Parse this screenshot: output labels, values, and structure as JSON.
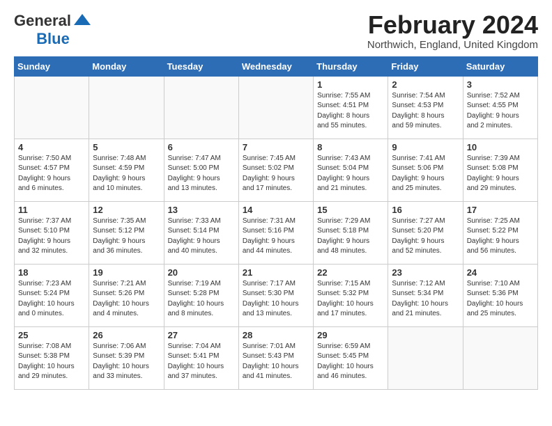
{
  "header": {
    "logo_general": "General",
    "logo_blue": "Blue",
    "month_title": "February 2024",
    "location": "Northwich, England, United Kingdom"
  },
  "days_of_week": [
    "Sunday",
    "Monday",
    "Tuesday",
    "Wednesday",
    "Thursday",
    "Friday",
    "Saturday"
  ],
  "weeks": [
    [
      {
        "num": "",
        "detail": ""
      },
      {
        "num": "",
        "detail": ""
      },
      {
        "num": "",
        "detail": ""
      },
      {
        "num": "",
        "detail": ""
      },
      {
        "num": "1",
        "detail": "Sunrise: 7:55 AM\nSunset: 4:51 PM\nDaylight: 8 hours\nand 55 minutes."
      },
      {
        "num": "2",
        "detail": "Sunrise: 7:54 AM\nSunset: 4:53 PM\nDaylight: 8 hours\nand 59 minutes."
      },
      {
        "num": "3",
        "detail": "Sunrise: 7:52 AM\nSunset: 4:55 PM\nDaylight: 9 hours\nand 2 minutes."
      }
    ],
    [
      {
        "num": "4",
        "detail": "Sunrise: 7:50 AM\nSunset: 4:57 PM\nDaylight: 9 hours\nand 6 minutes."
      },
      {
        "num": "5",
        "detail": "Sunrise: 7:48 AM\nSunset: 4:59 PM\nDaylight: 9 hours\nand 10 minutes."
      },
      {
        "num": "6",
        "detail": "Sunrise: 7:47 AM\nSunset: 5:00 PM\nDaylight: 9 hours\nand 13 minutes."
      },
      {
        "num": "7",
        "detail": "Sunrise: 7:45 AM\nSunset: 5:02 PM\nDaylight: 9 hours\nand 17 minutes."
      },
      {
        "num": "8",
        "detail": "Sunrise: 7:43 AM\nSunset: 5:04 PM\nDaylight: 9 hours\nand 21 minutes."
      },
      {
        "num": "9",
        "detail": "Sunrise: 7:41 AM\nSunset: 5:06 PM\nDaylight: 9 hours\nand 25 minutes."
      },
      {
        "num": "10",
        "detail": "Sunrise: 7:39 AM\nSunset: 5:08 PM\nDaylight: 9 hours\nand 29 minutes."
      }
    ],
    [
      {
        "num": "11",
        "detail": "Sunrise: 7:37 AM\nSunset: 5:10 PM\nDaylight: 9 hours\nand 32 minutes."
      },
      {
        "num": "12",
        "detail": "Sunrise: 7:35 AM\nSunset: 5:12 PM\nDaylight: 9 hours\nand 36 minutes."
      },
      {
        "num": "13",
        "detail": "Sunrise: 7:33 AM\nSunset: 5:14 PM\nDaylight: 9 hours\nand 40 minutes."
      },
      {
        "num": "14",
        "detail": "Sunrise: 7:31 AM\nSunset: 5:16 PM\nDaylight: 9 hours\nand 44 minutes."
      },
      {
        "num": "15",
        "detail": "Sunrise: 7:29 AM\nSunset: 5:18 PM\nDaylight: 9 hours\nand 48 minutes."
      },
      {
        "num": "16",
        "detail": "Sunrise: 7:27 AM\nSunset: 5:20 PM\nDaylight: 9 hours\nand 52 minutes."
      },
      {
        "num": "17",
        "detail": "Sunrise: 7:25 AM\nSunset: 5:22 PM\nDaylight: 9 hours\nand 56 minutes."
      }
    ],
    [
      {
        "num": "18",
        "detail": "Sunrise: 7:23 AM\nSunset: 5:24 PM\nDaylight: 10 hours\nand 0 minutes."
      },
      {
        "num": "19",
        "detail": "Sunrise: 7:21 AM\nSunset: 5:26 PM\nDaylight: 10 hours\nand 4 minutes."
      },
      {
        "num": "20",
        "detail": "Sunrise: 7:19 AM\nSunset: 5:28 PM\nDaylight: 10 hours\nand 8 minutes."
      },
      {
        "num": "21",
        "detail": "Sunrise: 7:17 AM\nSunset: 5:30 PM\nDaylight: 10 hours\nand 13 minutes."
      },
      {
        "num": "22",
        "detail": "Sunrise: 7:15 AM\nSunset: 5:32 PM\nDaylight: 10 hours\nand 17 minutes."
      },
      {
        "num": "23",
        "detail": "Sunrise: 7:12 AM\nSunset: 5:34 PM\nDaylight: 10 hours\nand 21 minutes."
      },
      {
        "num": "24",
        "detail": "Sunrise: 7:10 AM\nSunset: 5:36 PM\nDaylight: 10 hours\nand 25 minutes."
      }
    ],
    [
      {
        "num": "25",
        "detail": "Sunrise: 7:08 AM\nSunset: 5:38 PM\nDaylight: 10 hours\nand 29 minutes."
      },
      {
        "num": "26",
        "detail": "Sunrise: 7:06 AM\nSunset: 5:39 PM\nDaylight: 10 hours\nand 33 minutes."
      },
      {
        "num": "27",
        "detail": "Sunrise: 7:04 AM\nSunset: 5:41 PM\nDaylight: 10 hours\nand 37 minutes."
      },
      {
        "num": "28",
        "detail": "Sunrise: 7:01 AM\nSunset: 5:43 PM\nDaylight: 10 hours\nand 41 minutes."
      },
      {
        "num": "29",
        "detail": "Sunrise: 6:59 AM\nSunset: 5:45 PM\nDaylight: 10 hours\nand 46 minutes."
      },
      {
        "num": "",
        "detail": ""
      },
      {
        "num": "",
        "detail": ""
      }
    ]
  ]
}
